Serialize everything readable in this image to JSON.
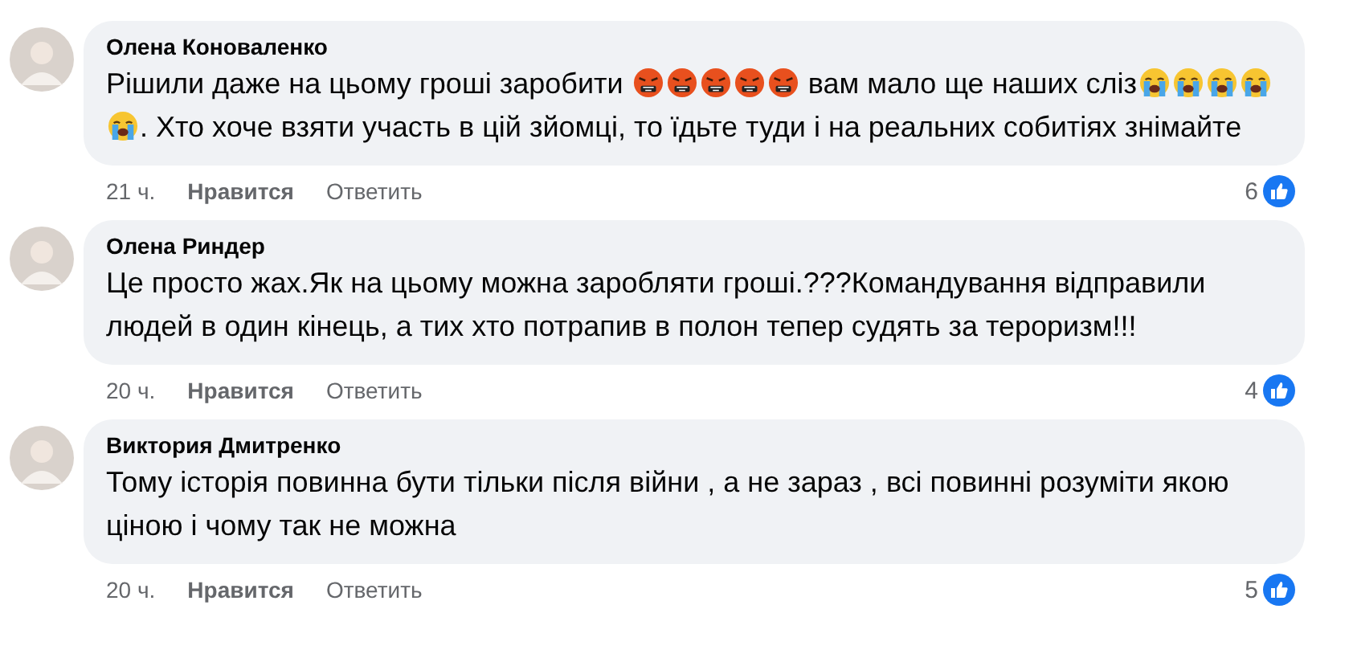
{
  "comments": [
    {
      "author": "Олена Коноваленко",
      "parts": [
        {
          "kind": "text",
          "text": "Рішили даже на цьому гроші заробити "
        },
        {
          "kind": "angry"
        },
        {
          "kind": "angry"
        },
        {
          "kind": "angry"
        },
        {
          "kind": "angry"
        },
        {
          "kind": "angry"
        },
        {
          "kind": "text",
          "text": " вам мало ще наших сліз"
        },
        {
          "kind": "crying"
        },
        {
          "kind": "crying"
        },
        {
          "kind": "crying"
        },
        {
          "kind": "crying"
        },
        {
          "kind": "crying"
        },
        {
          "kind": "text",
          "text": ". Хто хоче взяти участь в цій зйомці, то їдьте туди і на реальних собитіях знімайте"
        }
      ],
      "time": "21 ч.",
      "like": "Нравится",
      "reply": "Ответить",
      "likes": "6"
    },
    {
      "author": "Олена Риндер",
      "parts": [
        {
          "kind": "text",
          "text": "Це просто жах.Як на цьому можна заробляти гроші.???Командування відправили людей в один кінець, а тих хто потрапив в полон тепер судять за тероризм!!!"
        }
      ],
      "time": "20 ч.",
      "like": "Нравится",
      "reply": "Ответить",
      "likes": "4"
    },
    {
      "author": "Виктория Дмитренко",
      "parts": [
        {
          "kind": "text",
          "text": "Тому історія повинна бути тільки після війни , а не зараз , всі повинні розуміти якою ціною і чому так не можна"
        }
      ],
      "time": "20 ч.",
      "like": "Нравится",
      "reply": "Ответить",
      "likes": "5"
    }
  ]
}
